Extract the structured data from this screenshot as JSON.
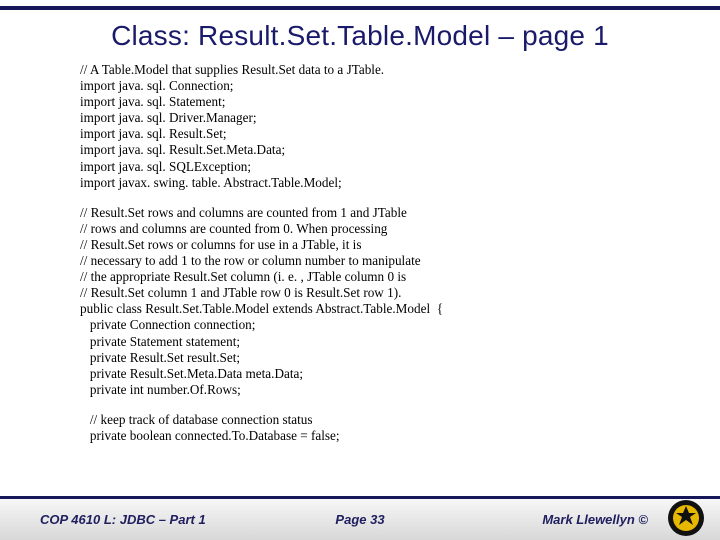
{
  "title": "Class:  Result.Set.Table.Model – page 1",
  "blocks": {
    "b1": [
      "// A Table.Model that supplies Result.Set data to a JTable.",
      "import java. sql. Connection;",
      "import java. sql. Statement;",
      "import java. sql. Driver.Manager;",
      "import java. sql. Result.Set;",
      "import java. sql. Result.Set.Meta.Data;",
      "import java. sql. SQLException;",
      "import javax. swing. table. Abstract.Table.Model;"
    ],
    "b2": [
      "// Result.Set rows and columns are counted from 1 and JTable",
      "// rows and columns are counted from 0. When processing",
      "// Result.Set rows or columns for use in a JTable, it is",
      "// necessary to add 1 to the row or column number to manipulate",
      "// the appropriate Result.Set column (i. e. , JTable column 0 is",
      "// Result.Set column 1 and JTable row 0 is Result.Set row 1).",
      "public class Result.Set.Table.Model extends Abstract.Table.Model  {",
      "   private Connection connection;",
      "   private Statement statement;",
      "   private Result.Set result.Set;",
      "   private Result.Set.Meta.Data meta.Data;",
      "   private int number.Of.Rows;"
    ],
    "b3": [
      "   // keep track of database connection status",
      "   private boolean connected.To.Database = false;"
    ]
  },
  "footer": {
    "left": "COP 4610 L: JDBC – Part 1",
    "center": "Page 33",
    "right": "Mark Llewellyn ©"
  }
}
